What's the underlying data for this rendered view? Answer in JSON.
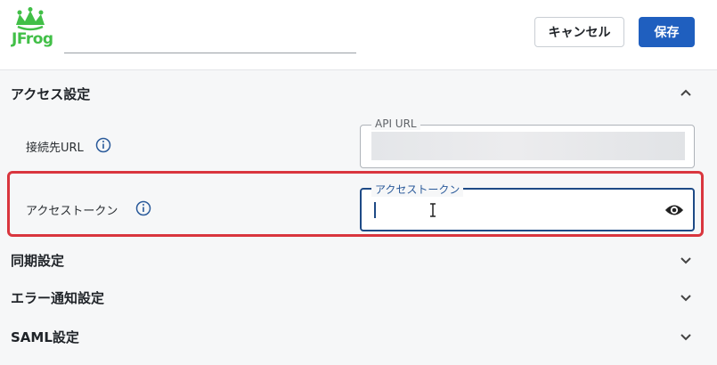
{
  "header": {
    "logo_text": "JFrog",
    "name_value": "",
    "cancel_label": "キャンセル",
    "save_label": "保存"
  },
  "access_settings": {
    "title": "アクセス設定",
    "expanded": true,
    "api_url": {
      "row_label": "接続先URL",
      "field_label": "API URL",
      "value": ""
    },
    "access_token": {
      "row_label": "アクセストークン",
      "field_label": "アクセストークン",
      "value": ""
    }
  },
  "sections": [
    {
      "title": "同期設定",
      "expanded": false
    },
    {
      "title": "エラー通知設定",
      "expanded": false
    },
    {
      "title": "SAML設定",
      "expanded": false
    }
  ],
  "colors": {
    "brand_green": "#41bf47",
    "primary_blue": "#1f5fbf",
    "highlight_red": "#d9363e"
  },
  "icons": {
    "logo": "jfrog-logo",
    "info": "info-icon",
    "show_password": "eye-icon",
    "collapse": "chevron-up-icon",
    "expand": "chevron-down-icon"
  }
}
